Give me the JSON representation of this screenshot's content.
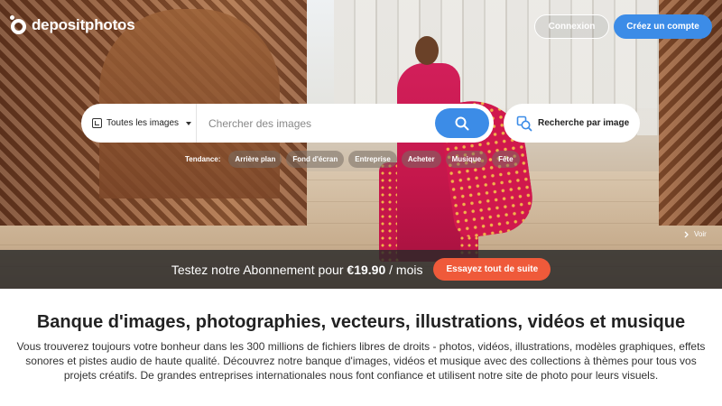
{
  "brand": {
    "name": "depositphotos"
  },
  "header": {
    "login_label": "Connexion",
    "signup_label": "Créez un compte"
  },
  "search": {
    "category_label": "Toutes les images",
    "placeholder": "Chercher des images",
    "visual_search_label": "Recherche par image"
  },
  "trending": {
    "label": "Tendance:",
    "tags": [
      "Arrière plan",
      "Fond d'écran",
      "Entreprise",
      "Acheter",
      "Musique",
      "Fête"
    ]
  },
  "hero": {
    "view_label": "Voir"
  },
  "promo": {
    "text_before": "Testez notre Abonnement pour ",
    "price": "€19.90",
    "text_after": " / mois",
    "button_label": "Essayez tout de suite"
  },
  "content": {
    "headline": "Banque d'images, photographies, vecteurs, illustrations, vidéos et musique",
    "description": "Vous trouverez toujours votre bonheur dans les 300 millions de fichiers libres de droits - photos, vidéos, illustrations, modèles graphiques, effets sonores et pistes audio de haute qualité. Découvrez notre banque d'images, vidéos et musique avec des collections à thèmes pour tous vos projets créatifs. De grandes entreprises internationales nous font confiance et utilisent notre site de photo pour leurs visuels."
  },
  "colors": {
    "accent_blue": "#3c8ce7",
    "promo_orange": "#ef5a3a",
    "promo_bar": "#282828"
  }
}
